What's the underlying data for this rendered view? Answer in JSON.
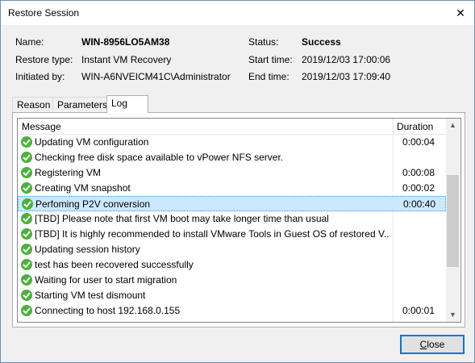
{
  "window": {
    "title": "Restore Session",
    "close_glyph": "✕"
  },
  "info": {
    "name_label": "Name:",
    "name_value": "WIN-8956LO5AM38",
    "type_label": "Restore type:",
    "type_value": "Instant VM Recovery",
    "initiated_label": "Initiated by:",
    "initiated_value": "WIN-A6NVEICM41C\\Administrator",
    "status_label": "Status:",
    "status_value": "Success",
    "start_label": "Start time:",
    "start_value": "2019/12/03 17:00:06",
    "end_label": "End time:",
    "end_value": "2019/12/03 17:09:40"
  },
  "tabs": [
    {
      "label": "Reason"
    },
    {
      "label": "Parameters"
    },
    {
      "label": "Log"
    }
  ],
  "log": {
    "col_message": "Message",
    "col_duration": "Duration",
    "rows": [
      {
        "message": "Updating VM configuration",
        "duration": "0:00:04"
      },
      {
        "message": "Checking free disk space available to vPower NFS server.",
        "duration": ""
      },
      {
        "message": "Registering VM",
        "duration": "0:00:08"
      },
      {
        "message": "Creating VM snapshot",
        "duration": "0:00:02"
      },
      {
        "message": "Perfoming P2V conversion",
        "duration": "0:00:40"
      },
      {
        "message": "[TBD] Please note that first VM boot may take longer time than usual",
        "duration": ""
      },
      {
        "message": "[TBD] It is highly recommended to install VMware Tools in Guest OS of restored V...",
        "duration": ""
      },
      {
        "message": "Updating session history",
        "duration": ""
      },
      {
        "message": "test has been recovered successfully",
        "duration": ""
      },
      {
        "message": "Waiting for user to start migration",
        "duration": ""
      },
      {
        "message": "Starting VM test dismount",
        "duration": ""
      },
      {
        "message": "Connecting to host 192.168.0.155",
        "duration": "0:00:01"
      }
    ]
  },
  "buttons": {
    "close_mnemonic": "C",
    "close_rest": "lose"
  },
  "colors": {
    "success": "#49b33a",
    "selection": "#cce8ff",
    "accent": "#0078d7"
  }
}
